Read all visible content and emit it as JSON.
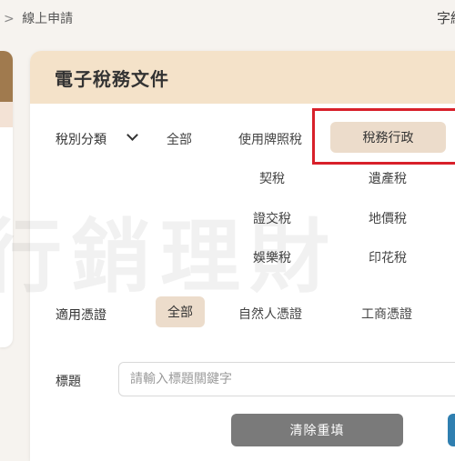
{
  "breadcrumb": {
    "prev_fragment": "",
    "separator": ">",
    "current": "線上申請"
  },
  "header": {
    "font_size_label": "字級"
  },
  "panel": {
    "title": "電子稅務文件"
  },
  "filters": {
    "tax_category": {
      "label": "稅別分類",
      "options": [
        "全部",
        "使用牌照稅",
        "稅務行政",
        "契稅",
        "遺產稅",
        "證交稅",
        "地價稅",
        "娛樂稅",
        "印花稅"
      ],
      "selected": "稅務行政"
    },
    "certificate": {
      "label": "適用憑證",
      "options": [
        "全部",
        "自然人憑證",
        "工商憑證"
      ],
      "selected": "全部"
    },
    "title": {
      "label": "標題",
      "placeholder": "請輸入標題關鍵字"
    }
  },
  "buttons": {
    "reset": "清除重填"
  },
  "watermark": "行銷理財",
  "colors": {
    "highlight": "#d8202a",
    "chip_bg": "#ecdccb",
    "header_bg": "#f4e2c9",
    "reset_bg": "#7a7a7a",
    "search_bg": "#2f7fb0"
  }
}
